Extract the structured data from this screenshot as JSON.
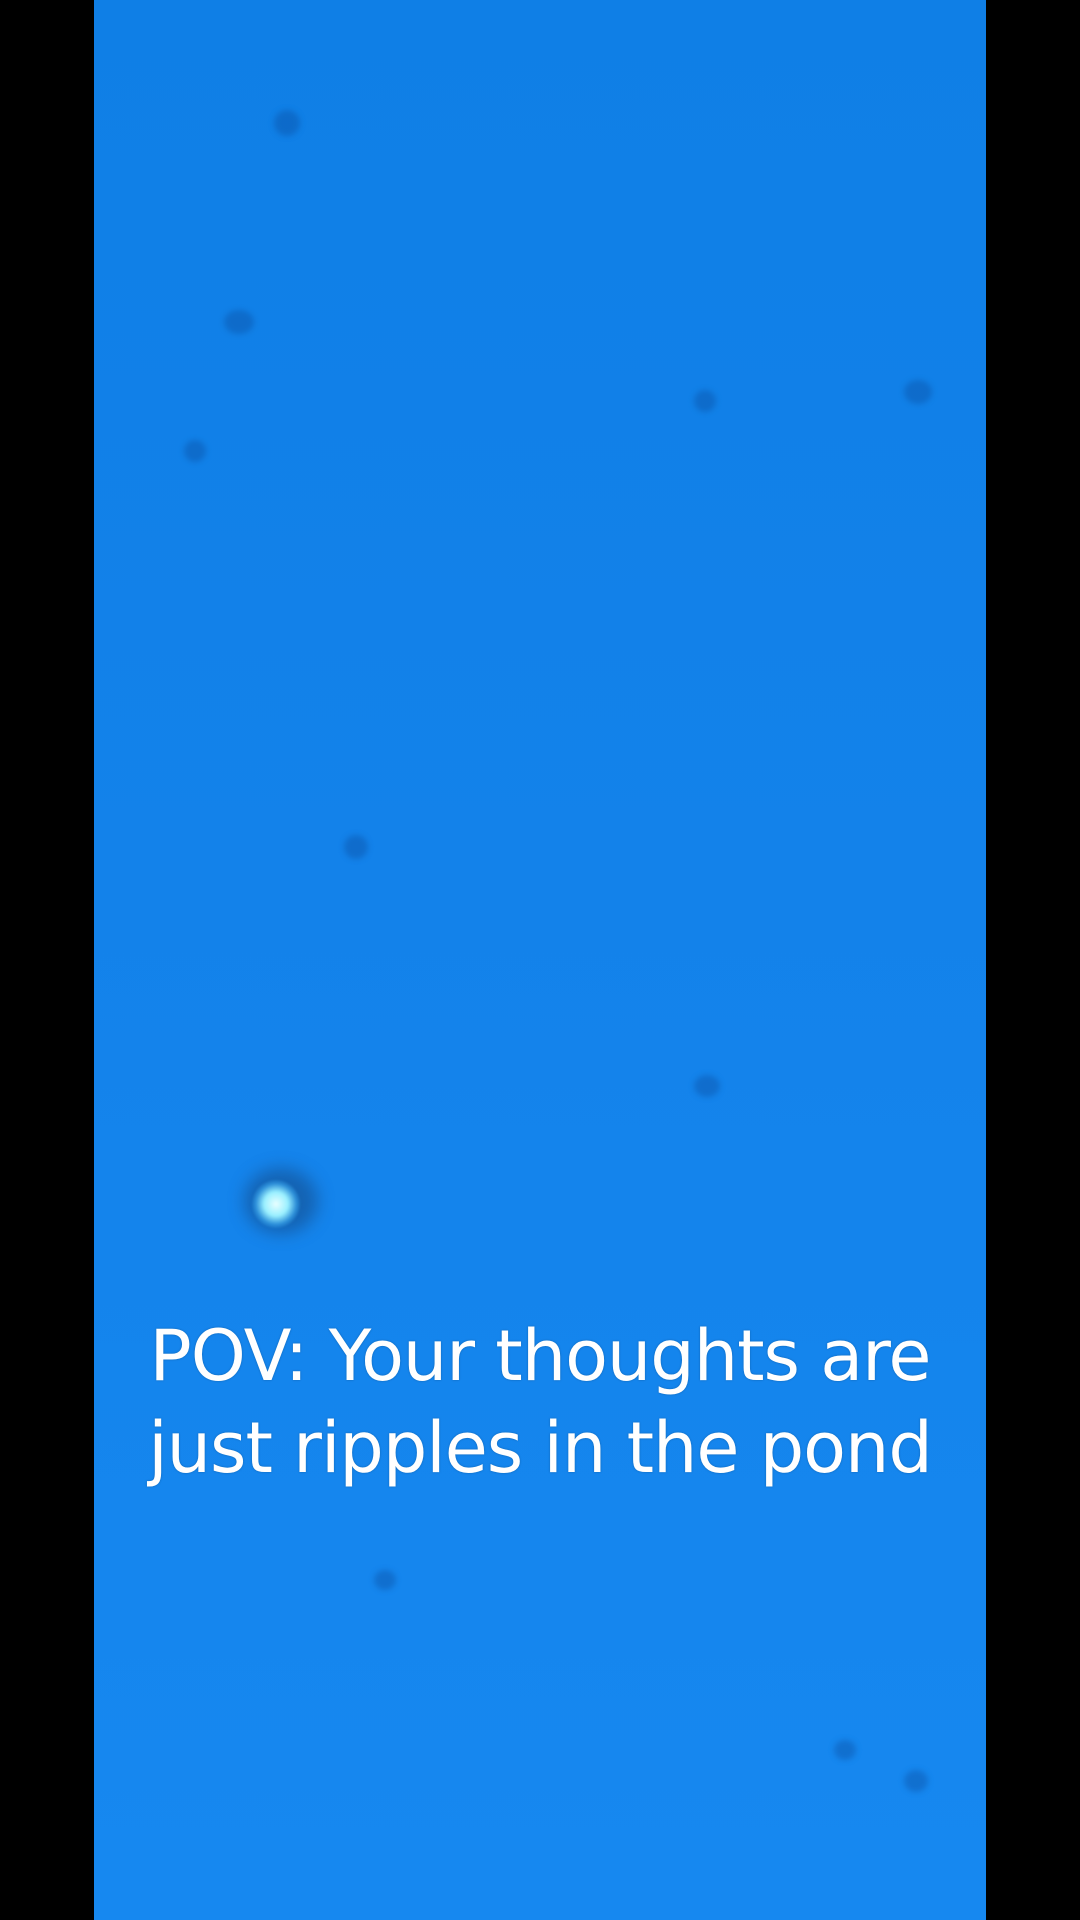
{
  "scene": {
    "description_colors": {
      "water": "#1382ea",
      "bars": "#000000",
      "glint": "#e9ffff"
    }
  },
  "caption": {
    "line1": "POV: Your thoughts are",
    "line2": "just ripples in the pond"
  }
}
